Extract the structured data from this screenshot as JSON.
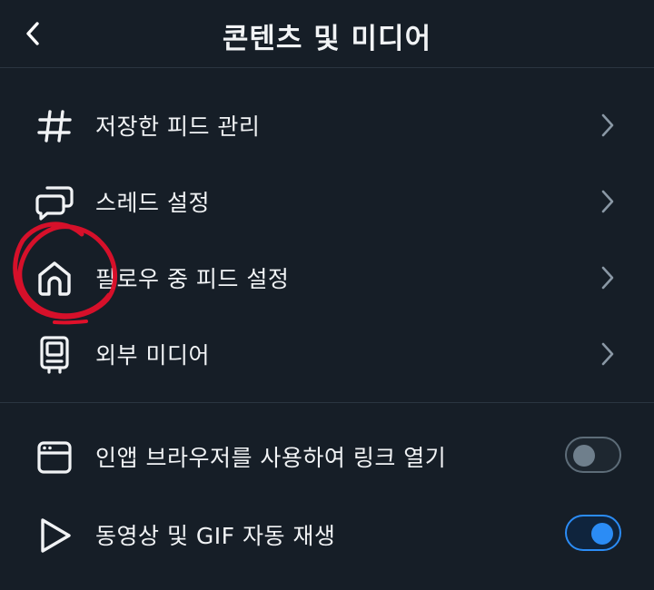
{
  "header": {
    "title": "콘텐츠 및 미디어",
    "back_icon": "chevron-left-icon"
  },
  "menu_items": [
    {
      "label": "저장한 피드 관리",
      "icon": "hashtag-icon"
    },
    {
      "label": "스레드 설정",
      "icon": "speech-bubbles-icon"
    },
    {
      "label": "필로우 중 피드 설정",
      "icon": "home-icon"
    },
    {
      "label": "외부 미디어",
      "icon": "media-player-icon"
    }
  ],
  "toggle_items": [
    {
      "label": "인앱 브라우저를 사용하여 링크 열기",
      "icon": "browser-window-icon",
      "enabled": false
    },
    {
      "label": "동영상 및 GIF 자동 재생",
      "icon": "play-icon",
      "enabled": true
    }
  ],
  "colors": {
    "background": "#161e27",
    "divider": "#2a3540",
    "text": "#f1f3f5",
    "chevron": "#8a98a5",
    "toggle_on": "#2b8cf5",
    "toggle_off": "#6f7f8c",
    "annotation_red": "#e0102a"
  }
}
